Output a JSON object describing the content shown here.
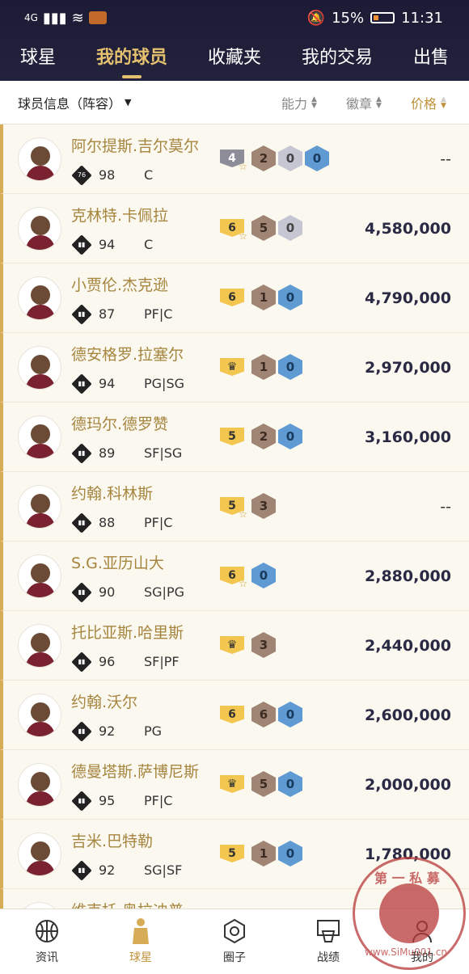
{
  "status_bar": {
    "network": "4G",
    "battery": "15%",
    "time": "11:31"
  },
  "tabs": [
    {
      "label": "球星",
      "active": false
    },
    {
      "label": "我的球员",
      "active": true
    },
    {
      "label": "收藏夹",
      "active": false
    },
    {
      "label": "我的交易",
      "active": false
    },
    {
      "label": "出售",
      "active": false
    }
  ],
  "filter": {
    "info_label": "球员信息（阵容）",
    "ability_label": "能力",
    "badge_label": "徽章",
    "price_label": "价格"
  },
  "players": [
    {
      "name": "阿尔提斯.吉尔莫尔",
      "rating_icon": "76",
      "overall": "98",
      "position": "C",
      "tier": "4",
      "tier_color": "grey",
      "star": true,
      "crown": false,
      "badges": [
        {
          "v": "2",
          "t": "bronze"
        },
        {
          "v": "0",
          "t": "silver"
        },
        {
          "v": "0",
          "t": "blue"
        }
      ],
      "price": "--"
    },
    {
      "name": "克林特.卡佩拉",
      "rating_icon": "bars",
      "overall": "94",
      "position": "C",
      "tier": "6",
      "tier_color": "gold",
      "star": true,
      "crown": false,
      "badges": [
        {
          "v": "5",
          "t": "bronze"
        },
        {
          "v": "0",
          "t": "silver"
        }
      ],
      "price": "4,580,000"
    },
    {
      "name": "小贾伦.杰克逊",
      "rating_icon": "bars",
      "overall": "87",
      "position": "PF|C",
      "tier": "6",
      "tier_color": "gold",
      "star": false,
      "crown": false,
      "badges": [
        {
          "v": "1",
          "t": "bronze"
        },
        {
          "v": "0",
          "t": "blue"
        }
      ],
      "price": "4,790,000"
    },
    {
      "name": "德安格罗.拉塞尔",
      "rating_icon": "bars",
      "overall": "94",
      "position": "PG|SG",
      "tier": "",
      "tier_color": "gold",
      "star": false,
      "crown": true,
      "badges": [
        {
          "v": "1",
          "t": "bronze"
        },
        {
          "v": "0",
          "t": "blue"
        }
      ],
      "price": "2,970,000"
    },
    {
      "name": "德玛尔.德罗赞",
      "rating_icon": "bars",
      "overall": "89",
      "position": "SF|SG",
      "tier": "5",
      "tier_color": "gold",
      "star": false,
      "crown": false,
      "badges": [
        {
          "v": "2",
          "t": "bronze"
        },
        {
          "v": "0",
          "t": "blue"
        }
      ],
      "price": "3,160,000"
    },
    {
      "name": "约翰.科林斯",
      "rating_icon": "bars",
      "overall": "88",
      "position": "PF|C",
      "tier": "5",
      "tier_color": "gold",
      "star": true,
      "crown": false,
      "badges": [
        {
          "v": "3",
          "t": "bronze"
        }
      ],
      "price": "--"
    },
    {
      "name": "S.G.亚历山大",
      "rating_icon": "bars",
      "overall": "90",
      "position": "SG|PG",
      "tier": "6",
      "tier_color": "gold",
      "star": true,
      "crown": false,
      "badges": [
        {
          "v": "0",
          "t": "blue"
        }
      ],
      "price": "2,880,000"
    },
    {
      "name": "托比亚斯.哈里斯",
      "rating_icon": "bars",
      "overall": "96",
      "position": "SF|PF",
      "tier": "",
      "tier_color": "gold",
      "star": false,
      "crown": true,
      "badges": [
        {
          "v": "3",
          "t": "bronze"
        }
      ],
      "price": "2,440,000"
    },
    {
      "name": "约翰.沃尔",
      "rating_icon": "bars",
      "overall": "92",
      "position": "PG",
      "tier": "6",
      "tier_color": "gold",
      "star": false,
      "crown": false,
      "badges": [
        {
          "v": "6",
          "t": "bronze"
        },
        {
          "v": "0",
          "t": "blue"
        }
      ],
      "price": "2,600,000"
    },
    {
      "name": "德曼塔斯.萨博尼斯",
      "rating_icon": "bars",
      "overall": "95",
      "position": "PF|C",
      "tier": "",
      "tier_color": "gold",
      "star": false,
      "crown": true,
      "badges": [
        {
          "v": "5",
          "t": "bronze"
        },
        {
          "v": "0",
          "t": "blue"
        }
      ],
      "price": "2,000,000"
    },
    {
      "name": "吉米.巴特勒",
      "rating_icon": "bars",
      "overall": "92",
      "position": "SG|SF",
      "tier": "5",
      "tier_color": "gold",
      "star": false,
      "crown": false,
      "badges": [
        {
          "v": "1",
          "t": "bronze"
        },
        {
          "v": "0",
          "t": "blue"
        }
      ],
      "price": "1,780,000"
    },
    {
      "name": "维克托.奥拉迪普",
      "rating_icon": "bars",
      "overall": "",
      "position": "",
      "tier": "",
      "tier_color": "gold",
      "star": false,
      "crown": false,
      "badges": [],
      "price": ""
    }
  ],
  "bottom_nav": [
    {
      "label": "资讯",
      "icon": "basketball-icon",
      "active": false
    },
    {
      "label": "球星",
      "icon": "player-icon",
      "active": true
    },
    {
      "label": "圈子",
      "icon": "circle-icon",
      "active": false
    },
    {
      "label": "战绩",
      "icon": "hoop-icon",
      "active": false
    },
    {
      "label": "我的",
      "icon": "profile-icon",
      "active": false
    }
  ],
  "watermark": {
    "top_text": "第 一 私 募",
    "url_text": "www.SiMu001.cn"
  }
}
